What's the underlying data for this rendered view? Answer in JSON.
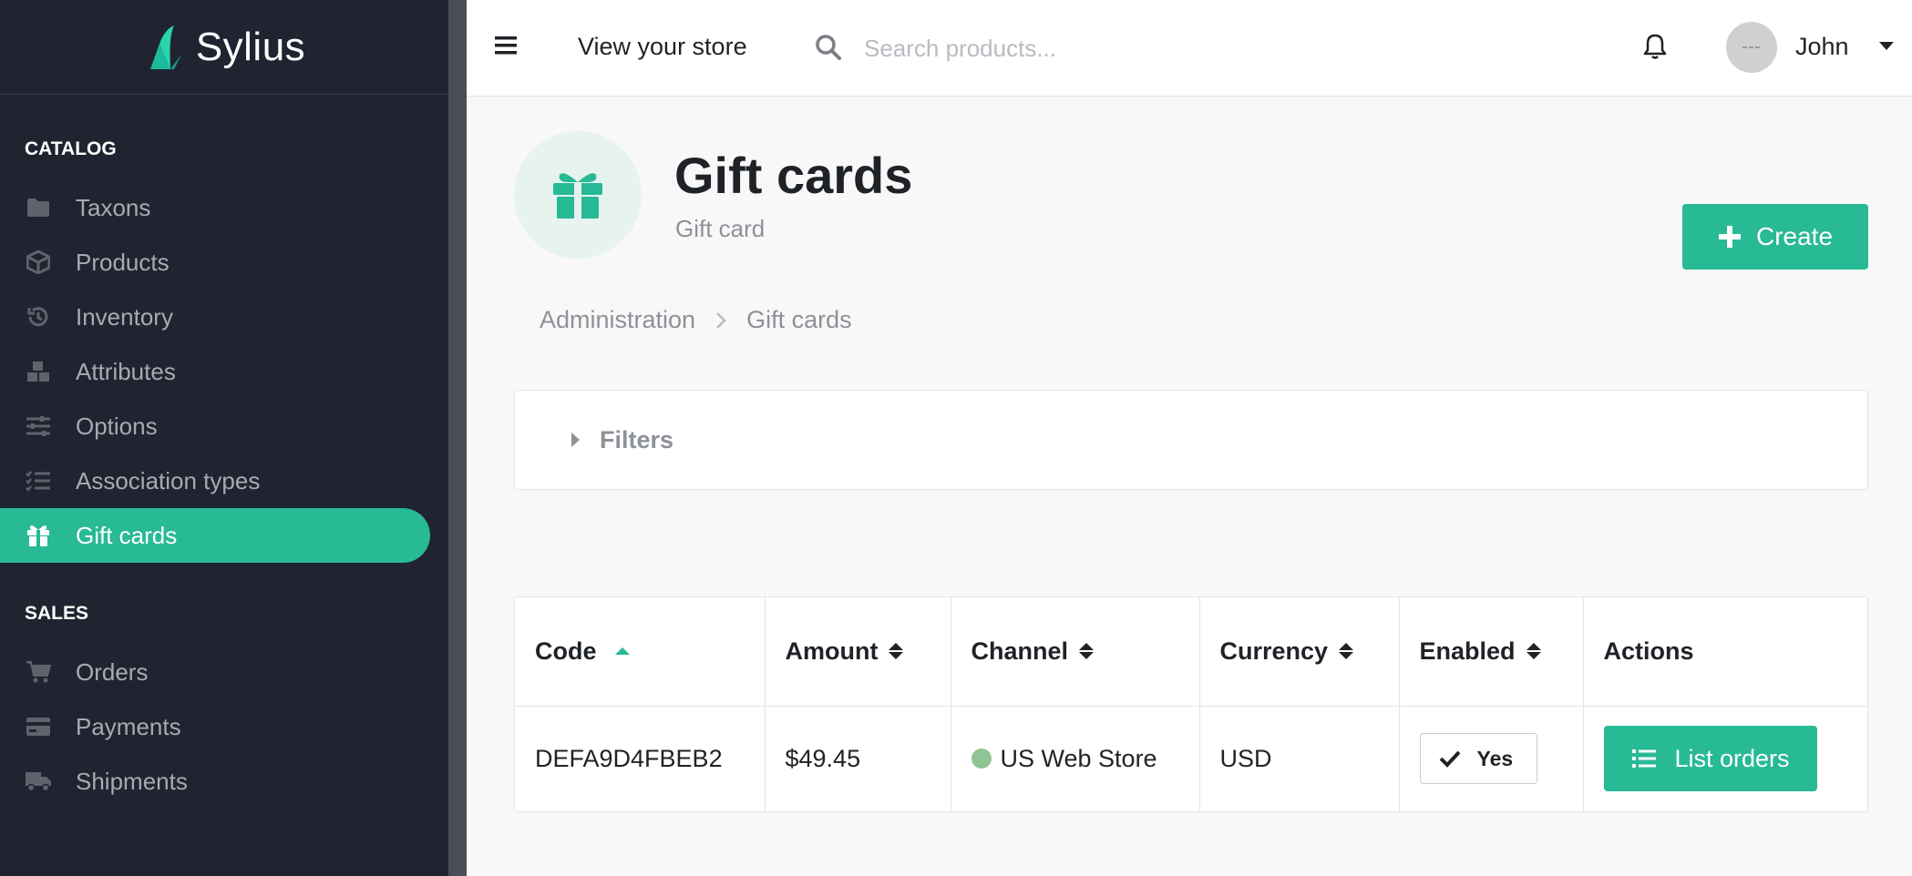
{
  "app": {
    "logo_text": "Sylius",
    "brand_color": "#28b995",
    "sidebar_bg": "#1f2430"
  },
  "sidebar": {
    "sections": [
      {
        "title": "CATALOG",
        "items": [
          {
            "label": "Taxons",
            "icon": "folder-icon"
          },
          {
            "label": "Products",
            "icon": "cube-icon"
          },
          {
            "label": "Inventory",
            "icon": "history-icon"
          },
          {
            "label": "Attributes",
            "icon": "cubes-icon"
          },
          {
            "label": "Options",
            "icon": "sliders-icon"
          },
          {
            "label": "Association types",
            "icon": "tasks-icon"
          },
          {
            "label": "Gift cards",
            "icon": "gift-icon",
            "active": true
          }
        ]
      },
      {
        "title": "SALES",
        "items": [
          {
            "label": "Orders",
            "icon": "cart-icon"
          },
          {
            "label": "Payments",
            "icon": "credit-card-icon"
          },
          {
            "label": "Shipments",
            "icon": "truck-icon"
          }
        ]
      }
    ]
  },
  "topbar": {
    "view_store": "View your store",
    "search_placeholder": "Search products...",
    "search_value": "",
    "user_name": "John"
  },
  "header": {
    "title": "Gift cards",
    "subtitle": "Gift card",
    "create_label": "Create",
    "icon": "gift-icon"
  },
  "breadcrumb": [
    "Administration",
    "Gift cards"
  ],
  "filters": {
    "label": "Filters"
  },
  "table": {
    "columns": [
      {
        "label": "Code",
        "sort": "asc"
      },
      {
        "label": "Amount",
        "sort": "both"
      },
      {
        "label": "Channel",
        "sort": "both"
      },
      {
        "label": "Currency",
        "sort": "both"
      },
      {
        "label": "Enabled",
        "sort": "both"
      },
      {
        "label": "Actions",
        "sort": "none"
      }
    ],
    "rows": [
      {
        "code": "DEFA9D4FBEB2",
        "amount": "$49.45",
        "channel": "US Web Store",
        "channel_color": "#8fc494",
        "currency": "USD",
        "enabled": "Yes",
        "action": "List orders"
      }
    ]
  }
}
